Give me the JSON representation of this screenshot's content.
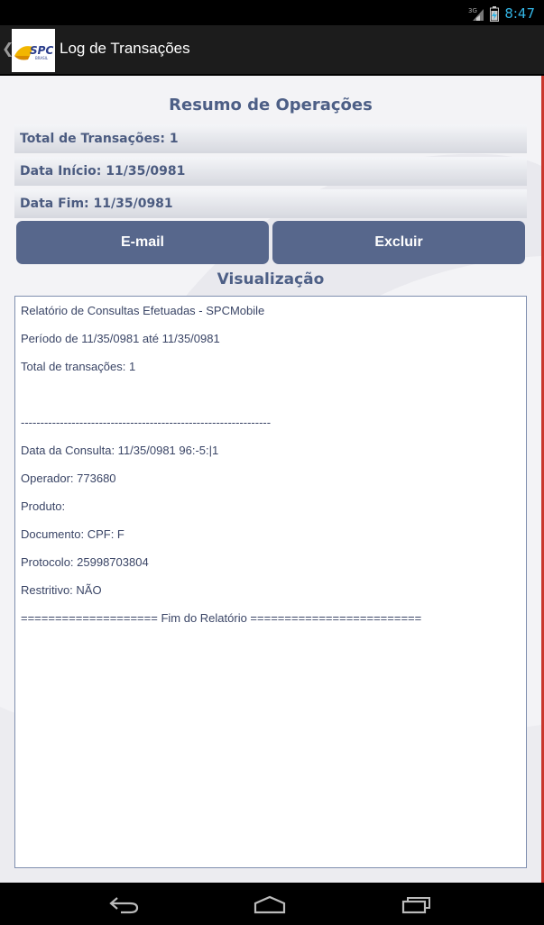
{
  "status_bar": {
    "network": "3G",
    "time": "8:47"
  },
  "action_bar": {
    "title": "Log de Transações",
    "logo_text": "SPC",
    "logo_subtext": "BRASIL"
  },
  "summary": {
    "title": "Resumo de Operações",
    "total": "Total de Transações: 1",
    "start_date": "Data Início: 11/35/0981",
    "end_date": "Data Fim: 11/35/0981"
  },
  "buttons": {
    "email_label": "E-mail",
    "delete_label": "Excluir"
  },
  "visualization": {
    "title": "Visualização",
    "lines": [
      "Relatório de Consultas Efetuadas - SPCMobile",
      "Período de 11/35/0981 até 11/35/0981",
      "Total de transações: 1",
      "",
      "----------------------------------------------------------------",
      "Data da Consulta: 11/35/0981 96:-5:|1",
      "Operador: 773680",
      "Produto:",
      "Documento: CPF:  F",
      "Protocolo: 25998703804",
      "Restritivo: NÃO",
      "==================== Fim do Relatório ========================="
    ]
  },
  "colors": {
    "accent": "#57678c",
    "heading": "#4d5f86",
    "clock": "#33b5e5",
    "edge": "#c9372d"
  }
}
